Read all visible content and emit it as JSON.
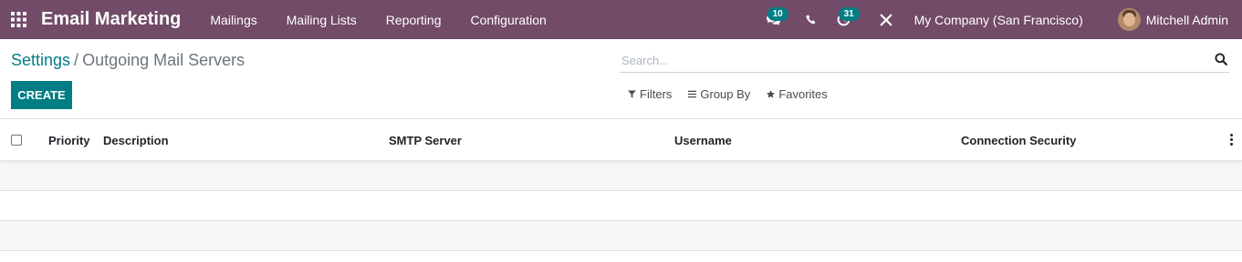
{
  "navbar": {
    "app_title": "Email Marketing",
    "menu": [
      "Mailings",
      "Mailing Lists",
      "Reporting",
      "Configuration"
    ],
    "messages_badge": "10",
    "activities_badge": "31",
    "company": "My Company (San Francisco)",
    "user_name": "Mitchell Admin",
    "color": "#714B67"
  },
  "breadcrumb": {
    "parent": "Settings",
    "separator": "/",
    "current": "Outgoing Mail Servers"
  },
  "buttons": {
    "create": "CREATE"
  },
  "search": {
    "placeholder": "Search...",
    "filters": "Filters",
    "group_by": "Group By",
    "favorites": "Favorites"
  },
  "list": {
    "columns": [
      "Priority",
      "Description",
      "SMTP Server",
      "Username",
      "Connection Security"
    ]
  },
  "colors": {
    "primary": "#017e84",
    "navbar": "#714B67"
  }
}
